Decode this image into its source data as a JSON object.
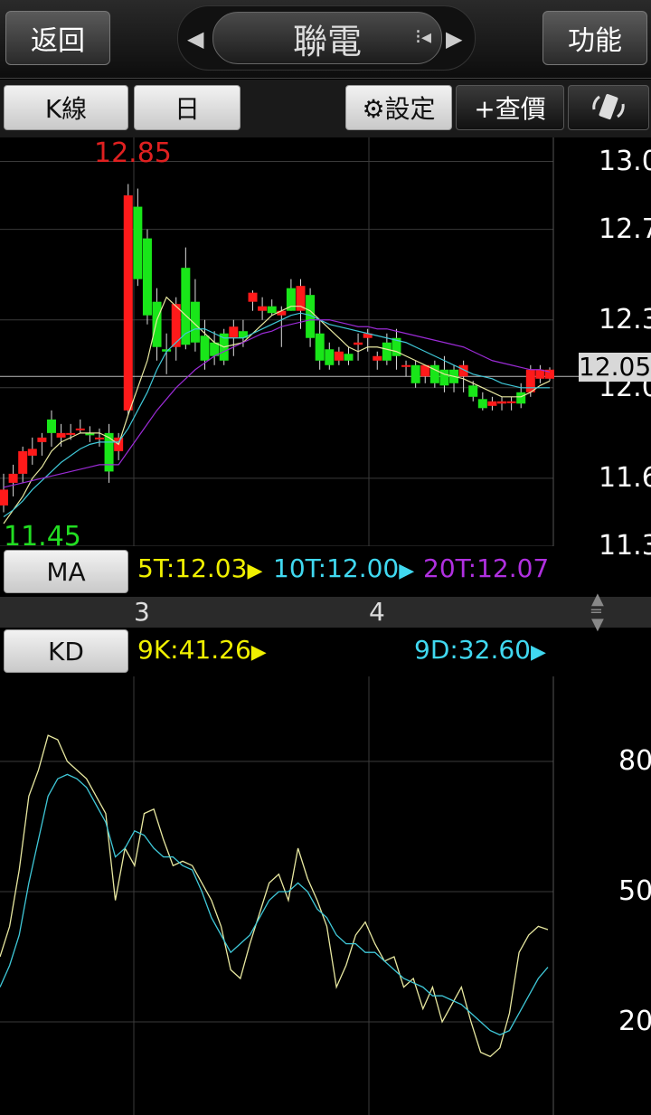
{
  "header": {
    "back_label": "返回",
    "title": "聯電",
    "function_label": "功能"
  },
  "toolbar": {
    "kline_label": "K線",
    "period_label": "日",
    "settings_label": "⚙設定",
    "quote_label": "+查價"
  },
  "price_chart": {
    "y_tick_labels": [
      "13.0",
      "12.7",
      "12.3",
      "12.0",
      "11.6",
      "11.3"
    ],
    "current_price_tag": "12.05",
    "high_label": "12.85",
    "low_label": "11.45",
    "colors": {
      "up": "#ff1a1a",
      "down": "#19e619",
      "ma5": "#e8e8a0",
      "ma10": "#3fc8d8",
      "ma20": "#9b2bd6"
    }
  },
  "ma_panel": {
    "button_label": "MA",
    "ma5": "5T:12.03",
    "ma10": "10T:12.00",
    "ma20": "20T:12.07"
  },
  "time_axis": {
    "labels": [
      "3",
      "4"
    ]
  },
  "kd_panel": {
    "button_label": "KD",
    "k_value": "9K:41.26",
    "d_value": "9D:32.60",
    "y_tick_labels": [
      "80",
      "50",
      "20"
    ]
  },
  "chart_data": [
    {
      "type": "candlestick",
      "ylim": [
        11.3,
        13.05
      ],
      "ohlc": [
        [
          11.48,
          11.62,
          11.45,
          11.55
        ],
        [
          11.58,
          11.66,
          11.52,
          11.62
        ],
        [
          11.62,
          11.74,
          11.58,
          11.72
        ],
        [
          11.7,
          11.78,
          11.66,
          11.73
        ],
        [
          11.76,
          11.8,
          11.7,
          11.78
        ],
        [
          11.86,
          11.9,
          11.74,
          11.8
        ],
        [
          11.78,
          11.84,
          11.74,
          11.8
        ],
        [
          11.8,
          11.84,
          11.77,
          11.8
        ],
        [
          11.82,
          11.86,
          11.8,
          11.82
        ],
        [
          11.8,
          11.83,
          11.76,
          11.79
        ],
        [
          11.78,
          11.82,
          11.74,
          11.78
        ],
        [
          11.8,
          11.84,
          11.58,
          11.63
        ],
        [
          11.72,
          11.8,
          11.68,
          11.78
        ],
        [
          11.9,
          12.9,
          11.88,
          12.85
        ],
        [
          12.8,
          12.88,
          12.45,
          12.48
        ],
        [
          12.66,
          12.7,
          12.28,
          12.32
        ],
        [
          12.38,
          12.44,
          12.12,
          12.18
        ],
        [
          12.17,
          12.24,
          12.06,
          12.16
        ],
        [
          12.18,
          12.4,
          12.12,
          12.37
        ],
        [
          12.53,
          12.62,
          12.17,
          12.19
        ],
        [
          12.38,
          12.48,
          12.16,
          12.2
        ],
        [
          12.23,
          12.3,
          12.08,
          12.12
        ],
        [
          12.2,
          12.25,
          12.1,
          12.14
        ],
        [
          12.24,
          12.26,
          12.1,
          12.12
        ],
        [
          12.22,
          12.3,
          12.14,
          12.27
        ],
        [
          12.25,
          12.3,
          12.18,
          12.22
        ],
        [
          12.38,
          12.43,
          12.34,
          12.42
        ],
        [
          12.34,
          12.4,
          12.3,
          12.36
        ],
        [
          12.36,
          12.39,
          12.32,
          12.33
        ],
        [
          12.32,
          12.36,
          12.18,
          12.34
        ],
        [
          12.44,
          12.48,
          12.34,
          12.34
        ],
        [
          12.34,
          12.48,
          12.26,
          12.45
        ],
        [
          12.41,
          12.44,
          12.18,
          12.22
        ],
        [
          12.24,
          12.3,
          12.08,
          12.12
        ],
        [
          12.17,
          12.2,
          12.08,
          12.1
        ],
        [
          12.12,
          12.18,
          12.1,
          12.16
        ],
        [
          12.15,
          12.18,
          12.1,
          12.12
        ],
        [
          12.19,
          12.24,
          12.12,
          12.2
        ],
        [
          12.22,
          12.26,
          12.16,
          12.24
        ],
        [
          12.12,
          12.16,
          12.08,
          12.14
        ],
        [
          12.2,
          12.24,
          12.1,
          12.12
        ],
        [
          12.22,
          12.26,
          12.08,
          12.14
        ],
        [
          12.1,
          12.12,
          12.05,
          12.1
        ],
        [
          12.1,
          12.12,
          12.0,
          12.02
        ],
        [
          12.05,
          12.1,
          12.02,
          12.1
        ],
        [
          12.1,
          12.12,
          12.0,
          12.02
        ],
        [
          12.08,
          12.14,
          11.98,
          12.01
        ],
        [
          12.08,
          12.1,
          11.98,
          12.02
        ],
        [
          12.05,
          12.12,
          11.98,
          12.1
        ],
        [
          12.01,
          12.03,
          11.94,
          11.96
        ],
        [
          11.95,
          11.98,
          11.9,
          11.91
        ],
        [
          11.92,
          11.96,
          11.9,
          11.94
        ],
        [
          11.93,
          11.96,
          11.9,
          11.94
        ],
        [
          11.94,
          11.96,
          11.9,
          11.94
        ],
        [
          11.98,
          12.02,
          11.91,
          11.93
        ],
        [
          11.98,
          12.1,
          11.96,
          12.08
        ],
        [
          12.04,
          12.1,
          12.02,
          12.08
        ],
        [
          12.04,
          12.09,
          12.03,
          12.08
        ]
      ],
      "ma5": [
        11.4,
        11.46,
        11.52,
        11.6,
        11.65,
        11.72,
        11.76,
        11.78,
        11.8,
        11.8,
        11.8,
        11.78,
        11.75,
        11.88,
        12.0,
        12.12,
        12.3,
        12.4,
        12.36,
        12.32,
        12.28,
        12.24,
        12.2,
        12.18,
        12.19,
        12.2,
        12.24,
        12.28,
        12.32,
        12.34,
        12.36,
        12.36,
        12.34,
        12.3,
        12.26,
        12.22,
        12.18,
        12.16,
        12.18,
        12.18,
        12.17,
        12.16,
        12.14,
        12.12,
        12.1,
        12.08,
        12.06,
        12.05,
        12.04,
        12.02,
        12.0,
        11.98,
        11.96,
        11.96,
        11.96,
        11.98,
        12.01,
        12.03
      ],
      "ma10": [
        11.43,
        11.46,
        11.5,
        11.55,
        11.59,
        11.63,
        11.67,
        11.7,
        11.73,
        11.75,
        11.76,
        11.76,
        11.76,
        11.82,
        11.9,
        11.98,
        12.08,
        12.16,
        12.2,
        12.24,
        12.26,
        12.26,
        12.24,
        12.22,
        12.22,
        12.22,
        12.24,
        12.26,
        12.28,
        12.3,
        12.32,
        12.33,
        12.32,
        12.3,
        12.28,
        12.27,
        12.26,
        12.25,
        12.24,
        12.23,
        12.22,
        12.21,
        12.2,
        12.18,
        12.16,
        12.14,
        12.12,
        12.1,
        12.08,
        12.06,
        12.05,
        12.04,
        12.02,
        12.01,
        12.0,
        12.0,
        12.0,
        12.0
      ],
      "ma20": [
        11.56,
        11.57,
        11.58,
        11.59,
        11.6,
        11.61,
        11.62,
        11.63,
        11.64,
        11.65,
        11.66,
        11.66,
        11.66,
        11.72,
        11.78,
        11.84,
        11.9,
        11.95,
        12.0,
        12.04,
        12.08,
        12.11,
        12.14,
        12.16,
        12.18,
        12.2,
        12.22,
        12.24,
        12.25,
        12.27,
        12.28,
        12.29,
        12.3,
        12.3,
        12.3,
        12.29,
        12.28,
        12.27,
        12.27,
        12.26,
        12.26,
        12.25,
        12.24,
        12.23,
        12.22,
        12.21,
        12.2,
        12.19,
        12.18,
        12.16,
        12.14,
        12.12,
        12.11,
        12.1,
        12.09,
        12.08,
        12.08,
        12.07
      ]
    },
    {
      "type": "line",
      "ylim": [
        0,
        100
      ],
      "series": [
        {
          "values": [
            35,
            42,
            55,
            72,
            78,
            86,
            85,
            80,
            78,
            76,
            72,
            68,
            48,
            60,
            56,
            68,
            69,
            62,
            56,
            57,
            56,
            52,
            48,
            42,
            32,
            30,
            38,
            45,
            52,
            54,
            48,
            60,
            53,
            48,
            42,
            28,
            33,
            40,
            43,
            38,
            34,
            35,
            28,
            30,
            23,
            28,
            20,
            24,
            28,
            20,
            13,
            12,
            14,
            22,
            36,
            40,
            42,
            41.26
          ]
        },
        {
          "values": [
            28,
            33,
            40,
            52,
            62,
            72,
            76,
            77,
            76,
            74,
            70,
            66,
            58,
            60,
            64,
            63,
            60,
            58,
            58,
            56,
            55,
            50,
            44,
            40,
            36,
            38,
            40,
            44,
            48,
            50,
            50,
            52,
            50,
            46,
            44,
            40,
            38,
            38,
            36,
            36,
            34,
            32,
            30,
            29,
            28,
            26,
            26,
            25,
            24,
            22,
            20,
            18,
            17,
            18,
            22,
            26,
            30,
            32.6
          ]
        }
      ],
      "y_ticks": [
        "80",
        "50",
        "20"
      ]
    }
  ]
}
